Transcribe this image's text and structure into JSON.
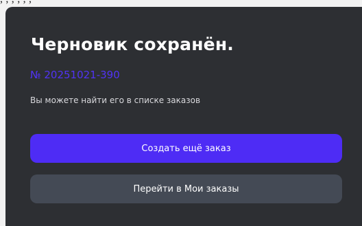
{
  "modal": {
    "title": "Черновик сохранён.",
    "order_number": "№ 20251021-390",
    "hint": "Вы можете найти его в списке заказов",
    "primary_button_label": "Создать ещё заказ",
    "secondary_button_label": "Перейти в Мои заказы"
  },
  "colors": {
    "modal_background": "#2d2f33",
    "accent": "#4e2cf5",
    "secondary_button": "#444a55",
    "order_number": "#5133f5"
  }
}
